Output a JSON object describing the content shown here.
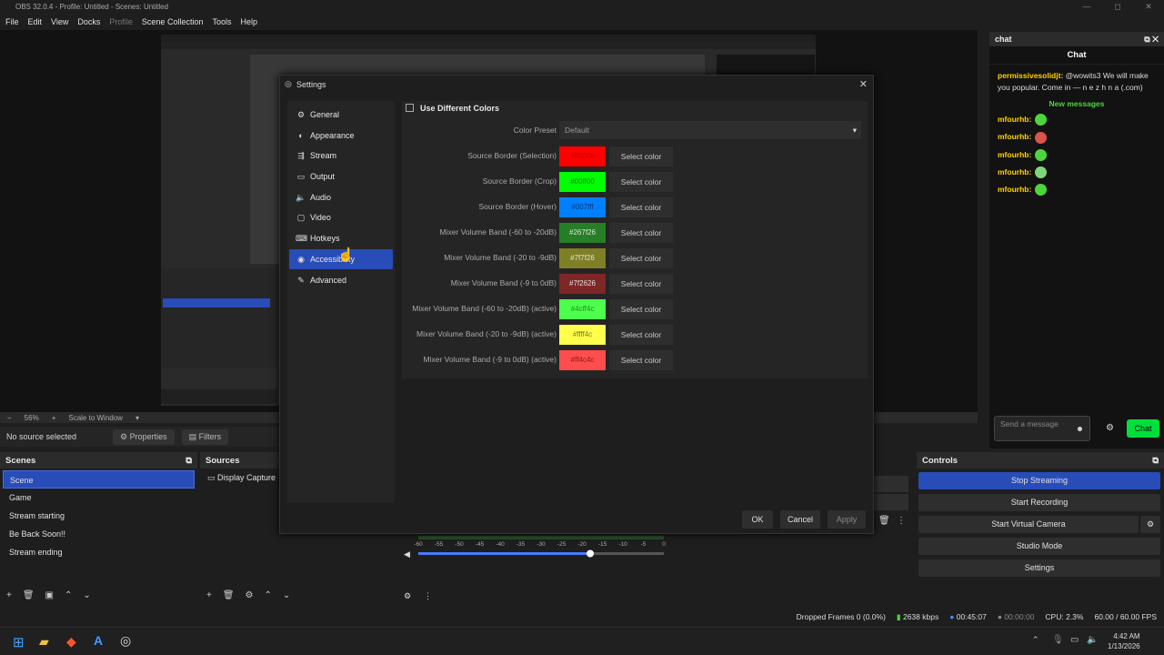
{
  "window": {
    "title": "OBS 32.0.4 - Profile: Untitled - Scenes: Untitled",
    "controls": [
      "—",
      "◻",
      "✕"
    ]
  },
  "menu": [
    "File",
    "Edit",
    "View",
    "Docks",
    "Profile",
    "Scene Collection",
    "Tools",
    "Help"
  ],
  "preview": {
    "zoom": "56%",
    "scale_label": "Scale to Window"
  },
  "source_bar": {
    "status": "No source selected",
    "properties": "Properties",
    "filters": "Filters"
  },
  "scenes": {
    "title": "Scenes",
    "items": [
      "Scene",
      "Game",
      "Stream starting",
      "Be Back Soon!!",
      "Stream ending"
    ]
  },
  "sources": {
    "title": "Sources",
    "items": [
      "Display Capture"
    ]
  },
  "mixer": {
    "ticks": [
      "-60",
      "-55",
      "-50",
      "-45",
      "-40",
      "-35",
      "-30",
      "-25",
      "-20",
      "-15",
      "-10",
      "-5",
      "0"
    ],
    "volume": 0.7
  },
  "controls": {
    "title": "Controls",
    "buttons": [
      "Stop Streaming",
      "Start Recording",
      "Start Virtual Camera",
      "Studio Mode",
      "Settings"
    ]
  },
  "statusbar": {
    "dropped": "Dropped Frames 0 (0.0%)",
    "bitrate": "2638 kbps",
    "stream_time": "00:45:07",
    "rec_time": "00:00:00",
    "cpu": "CPU: 2.3%",
    "fps": "60.00 / 60.00 FPS"
  },
  "taskbar": {
    "time": "4:42 AM",
    "date": "1/13/2026"
  },
  "chat": {
    "dock_title": "chat",
    "title": "Chat",
    "first_msg_user": "permissivesolidjt:",
    "first_msg_text": "@wowits3 We will make you popular. Come in — n e z h n a (.com)",
    "new_messages": "New messages",
    "messages": [
      {
        "user": "mfourhb:",
        "emote_color": "#4cd63c"
      },
      {
        "user": "mfourhb:",
        "emote_color": "#d9534f"
      },
      {
        "user": "mfourhb:",
        "emote_color": "#4cd63c"
      },
      {
        "user": "mfourhb:",
        "emote_color": "#7fd67a"
      },
      {
        "user": "mfourhb:",
        "emote_color": "#4cd63c"
      }
    ],
    "input_placeholder": "Send a message",
    "send": "Chat"
  },
  "settings": {
    "title": "Settings",
    "nav": [
      "General",
      "Appearance",
      "Stream",
      "Output",
      "Audio",
      "Video",
      "Hotkeys",
      "Accessibility",
      "Advanced"
    ],
    "nav_icons": [
      "⚙",
      "◐",
      "⇶",
      "▭",
      "🔈",
      "▢",
      "⌨",
      "◉",
      "✎"
    ],
    "selected_nav": "Accessibility",
    "use_different_colors": "Use Different Colors",
    "color_preset_label": "Color Preset",
    "color_preset_value": "Default",
    "select_color": "Select color",
    "rows": [
      {
        "label": "Source Border (Selection)",
        "value": "#ff0000",
        "bg": "#ff0000",
        "fg": "#c00000"
      },
      {
        "label": "Source Border (Crop)",
        "value": "#00ff00",
        "bg": "#00ff00",
        "fg": "#008800"
      },
      {
        "label": "Source Border (Hover)",
        "value": "#007fff",
        "bg": "#007fff",
        "fg": "#003c80"
      },
      {
        "label": "Mixer Volume Band (-60 to -20dB)",
        "value": "#267f26",
        "bg": "#267f26",
        "fg": "#e0e0e0"
      },
      {
        "label": "Mixer Volume Band (-20 to -9dB)",
        "value": "#7f7f26",
        "bg": "#7f7f26",
        "fg": "#e0e0e0"
      },
      {
        "label": "Mixer Volume Band (-9 to 0dB)",
        "value": "#7f2626",
        "bg": "#7f2626",
        "fg": "#e0e0e0"
      },
      {
        "label": "Mixer Volume Band (-60 to -20dB) (active)",
        "value": "#4cff4c",
        "bg": "#4cff4c",
        "fg": "#2a8a2a"
      },
      {
        "label": "Mixer Volume Band (-20 to -9dB) (active)",
        "value": "#ffff4c",
        "bg": "#ffff4c",
        "fg": "#7a7a20"
      },
      {
        "label": "Mixer Volume Band (-9 to 0dB) (active)",
        "value": "#ff4c4c",
        "bg": "#ff4c4c",
        "fg": "#8a2020"
      }
    ],
    "ok": "OK",
    "cancel": "Cancel",
    "apply": "Apply"
  }
}
